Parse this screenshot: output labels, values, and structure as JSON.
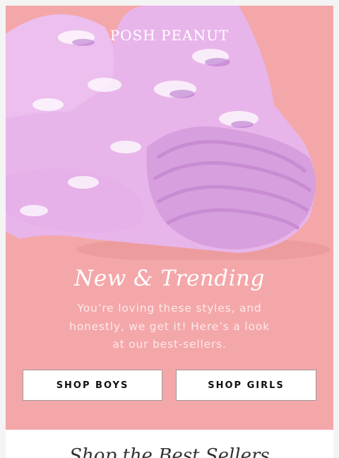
{
  "hero": {
    "brand": "POSH PEANUT",
    "headline": "New & Trending",
    "subcopy": "You’re loving these styles, and honestly, we get it! Here’s a look at our best-sellers.",
    "buttons": {
      "boys": "SHOP BOYS",
      "girls": "SHOP GIRLS"
    },
    "colors": {
      "background": "#f4a7a9",
      "outfit": "#e6b6ea",
      "ruffle": "#d7a0df"
    }
  },
  "next_section": {
    "heading": "Shop the Best Sellers"
  }
}
